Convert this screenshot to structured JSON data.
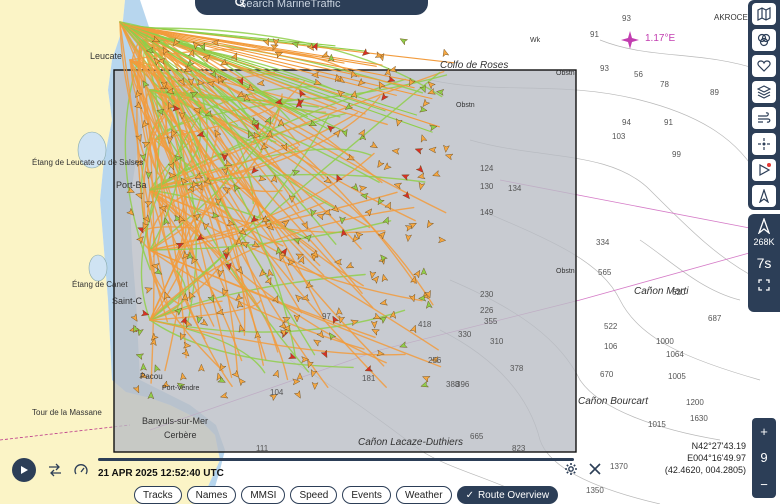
{
  "search": {
    "placeholder": "Search MarineTraffic"
  },
  "map": {
    "place_labels": [
      "Leucate",
      "Étang de Leucate ou de Salses",
      "Port-Ba",
      "Étang de Canet",
      "Saint-C",
      "Pacou",
      "Port-Vendre",
      "Tour de la Massane",
      "Banyuls-sur-Mer",
      "Cerbère",
      "Colfo de Roses",
      "AKROCE",
      "Cañon Marti",
      "Cañon Bourcart",
      "Cañon Lacaze-Duthiers",
      "Obstn",
      "Wk"
    ],
    "mag_variation": "1.17°E",
    "depths": [
      "93",
      "91",
      "93",
      "56",
      "78",
      "89",
      "91",
      "94",
      "103",
      "99",
      "124",
      "130",
      "134",
      "149",
      "230",
      "226",
      "355",
      "310",
      "334",
      "522",
      "620",
      "687",
      "1000",
      "1064",
      "1005",
      "1200",
      "1015",
      "1370",
      "1630",
      "565",
      "670",
      "378",
      "396",
      "388",
      "256",
      "181",
      "97",
      "104",
      "111",
      "665",
      "823",
      "418",
      "330",
      "1350",
      "106"
    ],
    "colors": {
      "land": "#fbf4c6",
      "shallow": "#b7d6ee",
      "sea": "#ffffff",
      "route_box": "#b9bcc4",
      "track_orange": "#f29b3c",
      "track_green": "#8fcf4a"
    }
  },
  "toolbar": {
    "icons": [
      "map-icon",
      "layers-icon",
      "heart-icon",
      "stack-icon",
      "wind-icon",
      "measure-icon",
      "play-icon",
      "compass-icon"
    ],
    "vessels_count": "268K",
    "time_label": "7s",
    "fullscreen_icon": "fullscreen-icon"
  },
  "zoom": {
    "plus": "+",
    "level": "9",
    "minus": "−"
  },
  "coords": {
    "lat": "N42°27'43.19",
    "lon": "E004°16'49.97",
    "decimal": "(42.4620, 004.2805)"
  },
  "playback": {
    "timestamp": "21 APR 2025 12:52:40 UTC"
  },
  "chips": [
    {
      "label": "Tracks",
      "active": false
    },
    {
      "label": "Names",
      "active": false
    },
    {
      "label": "MMSI",
      "active": false
    },
    {
      "label": "Speed",
      "active": false
    },
    {
      "label": "Events",
      "active": false
    },
    {
      "label": "Weather",
      "active": false
    },
    {
      "label": "Route Overview",
      "active": true
    }
  ]
}
